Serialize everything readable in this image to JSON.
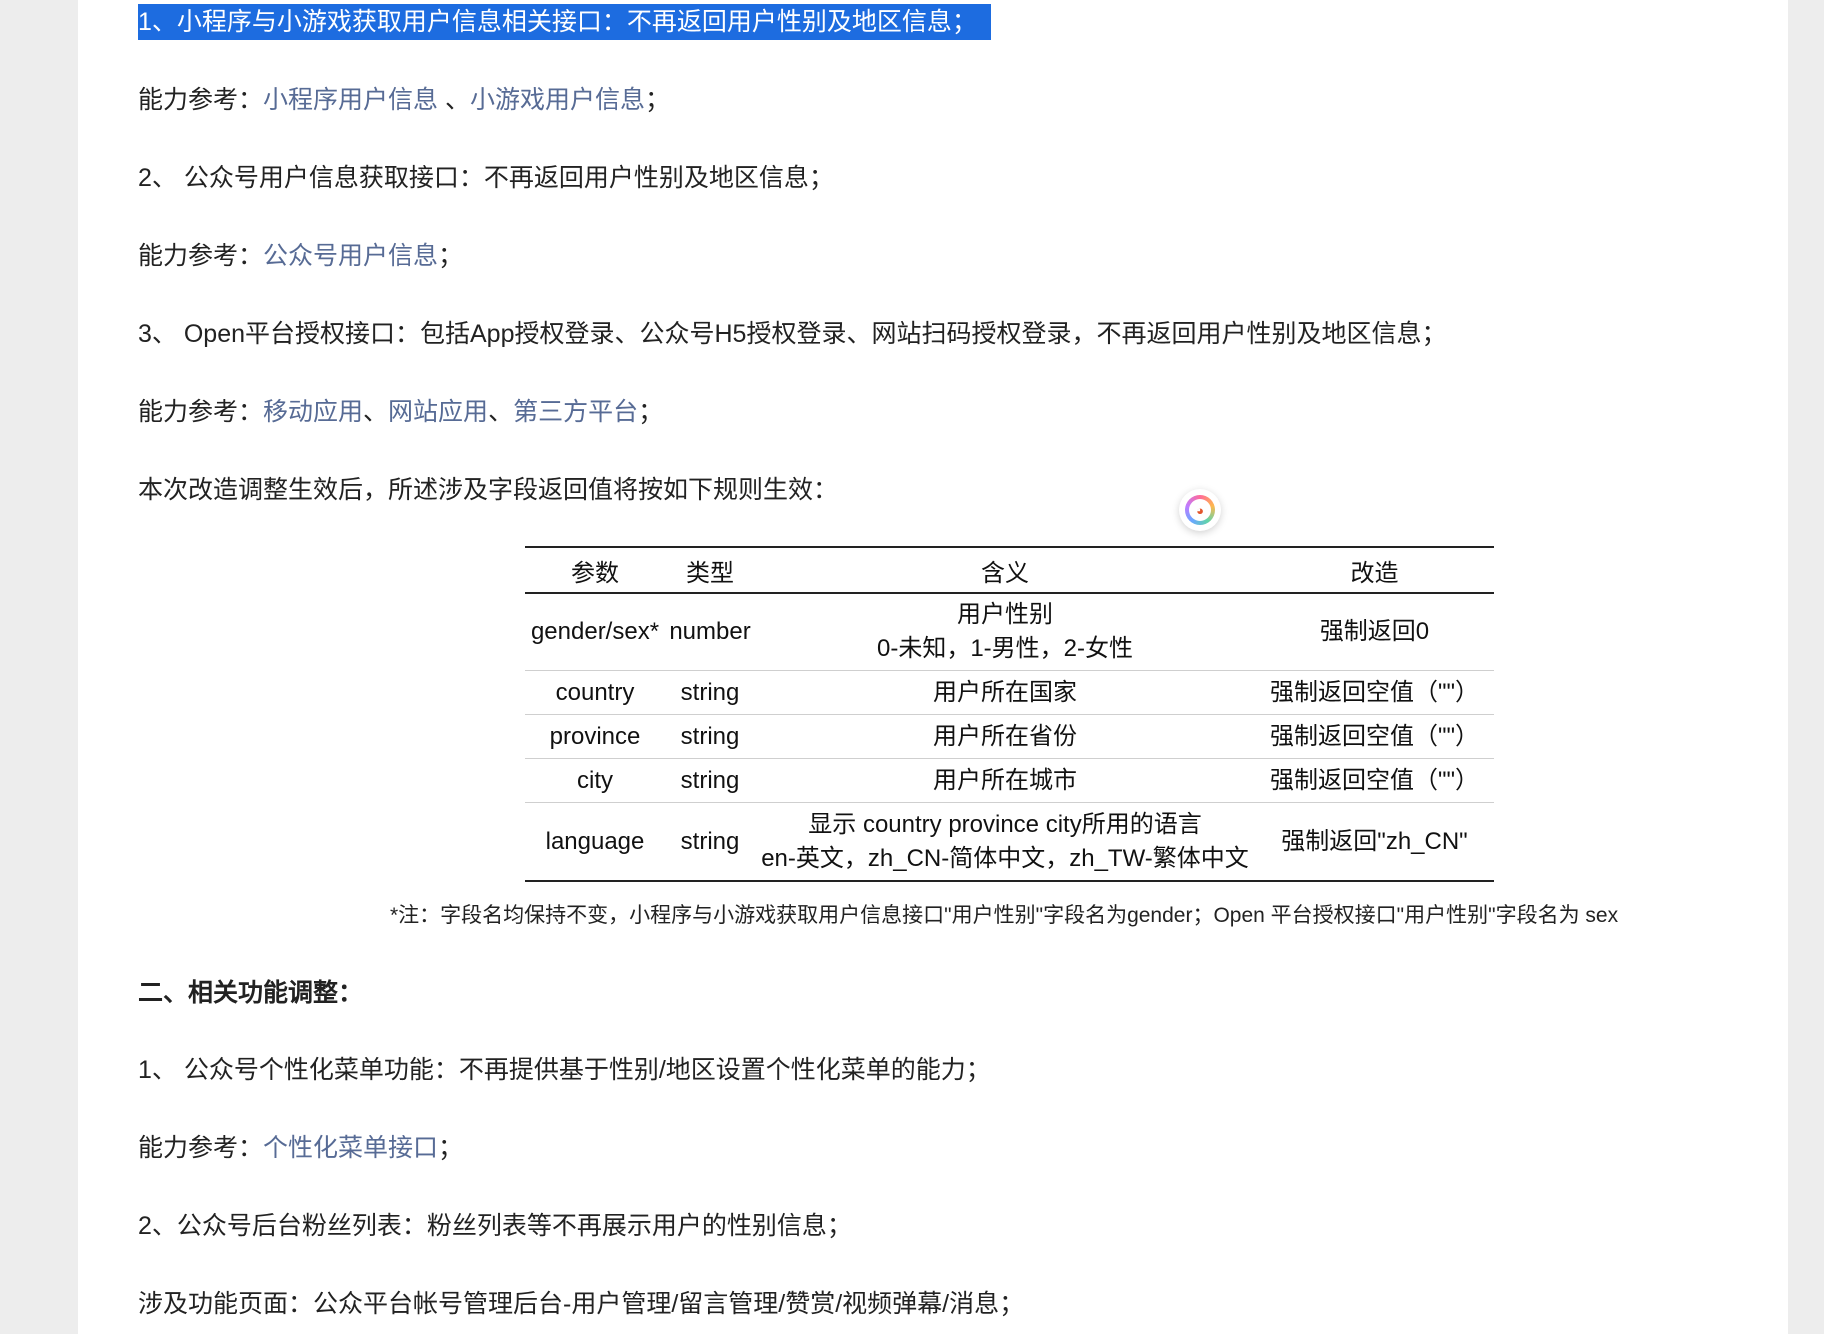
{
  "section1": {
    "item1": "1、小程序与小游戏获取用户信息相关接口：不再返回用户性别及地区信息；",
    "ref1_prefix": "能力参考：",
    "ref1_link1": "小程序用户信息",
    "ref1_sep": " 、",
    "ref1_link2": "小游戏用户信息",
    "ref1_end": "；",
    "item2": "2、 公众号用户信息获取接口：不再返回用户性别及地区信息；",
    "ref2_prefix": "能力参考：",
    "ref2_link1": "公众号用户信息",
    "ref2_end": "；",
    "item3": "3、 Open平台授权接口：包括App授权登录、公众号H5授权登录、网站扫码授权登录，不再返回用户性别及地区信息；",
    "ref3_prefix": "能力参考：",
    "ref3_link1": "移动应用",
    "ref3_sep1": "、",
    "ref3_link2": "网站应用",
    "ref3_sep2": "、",
    "ref3_link3": "第三方平台",
    "ref3_end": "；",
    "rule_intro": "本次改造调整生效后，所述涉及字段返回值将按如下规则生效："
  },
  "table": {
    "headers": [
      "参数",
      "类型",
      "含义",
      "改造"
    ],
    "rows": [
      {
        "param": "gender/sex*",
        "type": "number",
        "meaning1": "用户性别",
        "meaning2": "0-未知，1-男性，2-女性",
        "change": "强制返回0"
      },
      {
        "param": "country",
        "type": "string",
        "meaning1": "用户所在国家",
        "meaning2": "",
        "change": "强制返回空值（\"\"）"
      },
      {
        "param": "province",
        "type": "string",
        "meaning1": "用户所在省份",
        "meaning2": "",
        "change": "强制返回空值（\"\"）"
      },
      {
        "param": "city",
        "type": "string",
        "meaning1": "用户所在城市",
        "meaning2": "",
        "change": "强制返回空值（\"\"）"
      },
      {
        "param": "language",
        "type": "string",
        "meaning1": "显示 country province city所用的语言",
        "meaning2": "en-英文，zh_CN-简体中文，zh_TW-繁体中文",
        "change": "强制返回\"zh_CN\""
      }
    ],
    "note": "*注：字段名均保持不变，小程序与小游戏获取用户信息接口\"用户性别\"字段名为gender；Open 平台授权接口\"用户性别\"字段名为 sex"
  },
  "section2": {
    "title": "二、相关功能调整：",
    "item1": "1、 公众号个性化菜单功能：不再提供基于性别/地区设置个性化菜单的能力；",
    "ref1_prefix": "能力参考：",
    "ref1_link1": "个性化菜单接口",
    "ref1_end": "；",
    "item2": "2、公众号后台粉丝列表：粉丝列表等不再展示用户的性别信息；",
    "scope": "涉及功能页面：公众平台帐号管理后台-用户管理/留言管理/赞赏/视频弹幕/消息；"
  },
  "colors": {
    "link": "#576b95",
    "highlight": "#1d6ce0"
  },
  "floating_icon": "assistant-bubble-icon"
}
